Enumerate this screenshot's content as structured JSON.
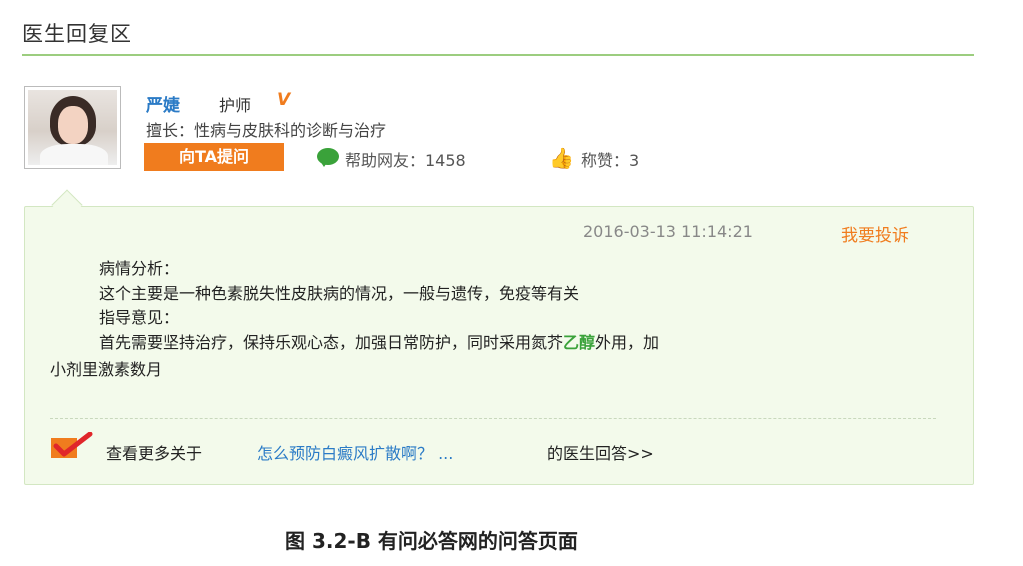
{
  "section": {
    "title": "医生回复区"
  },
  "doctor": {
    "name": "严婕",
    "title": "护师",
    "verified_icon": "v-badge-icon",
    "specialty": "擅长：性病与皮肤科的诊断与治疗",
    "ask_button": "向TA提问",
    "help_label": "帮助网友：1458",
    "like_label": "称赞：3"
  },
  "answer": {
    "timestamp": "2016-03-13 11:14:21",
    "complain_link": "我要投诉",
    "lines": {
      "l1": "病情分析：",
      "l2": "这个主要是一种色素脱失性皮肤病的情况，一般与遗传，免疫等有关",
      "l3": "指导意见：",
      "l4_before": "首先需要坚持治疗，保持乐观心态，加强日常防护，同时采用氮芥",
      "l4_green": "乙醇",
      "l4_after": "外用，加",
      "l5": "小剂里激素数月"
    },
    "more_prefix": "查看更多关于",
    "more_link": "怎么预防白癜风扩散啊？ ...",
    "more_suffix": "的医生回答>>"
  },
  "caption": "图 3.2-B  有问必答网的问答页面",
  "colors": {
    "accent_orange": "#f07c1e",
    "link_blue": "#2b7bc6",
    "green": "#3aa23a",
    "box_bg": "#f3faeb"
  }
}
